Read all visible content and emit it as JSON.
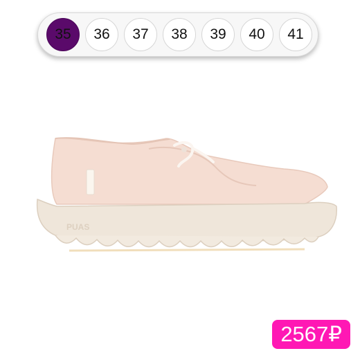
{
  "sizes": {
    "selected": "35",
    "options": [
      "35",
      "36",
      "37",
      "38",
      "39",
      "40",
      "41"
    ]
  },
  "product": {
    "image_icon": "canvas-slip-on-shoe",
    "sole_brand": "PUAS",
    "colors": {
      "upper": "#f5ddd2",
      "sole": "#efe6da"
    }
  },
  "price": {
    "label": "2567₽",
    "color": "#ff18b4"
  },
  "accent": {
    "selected_size": "#5a0a6a"
  }
}
